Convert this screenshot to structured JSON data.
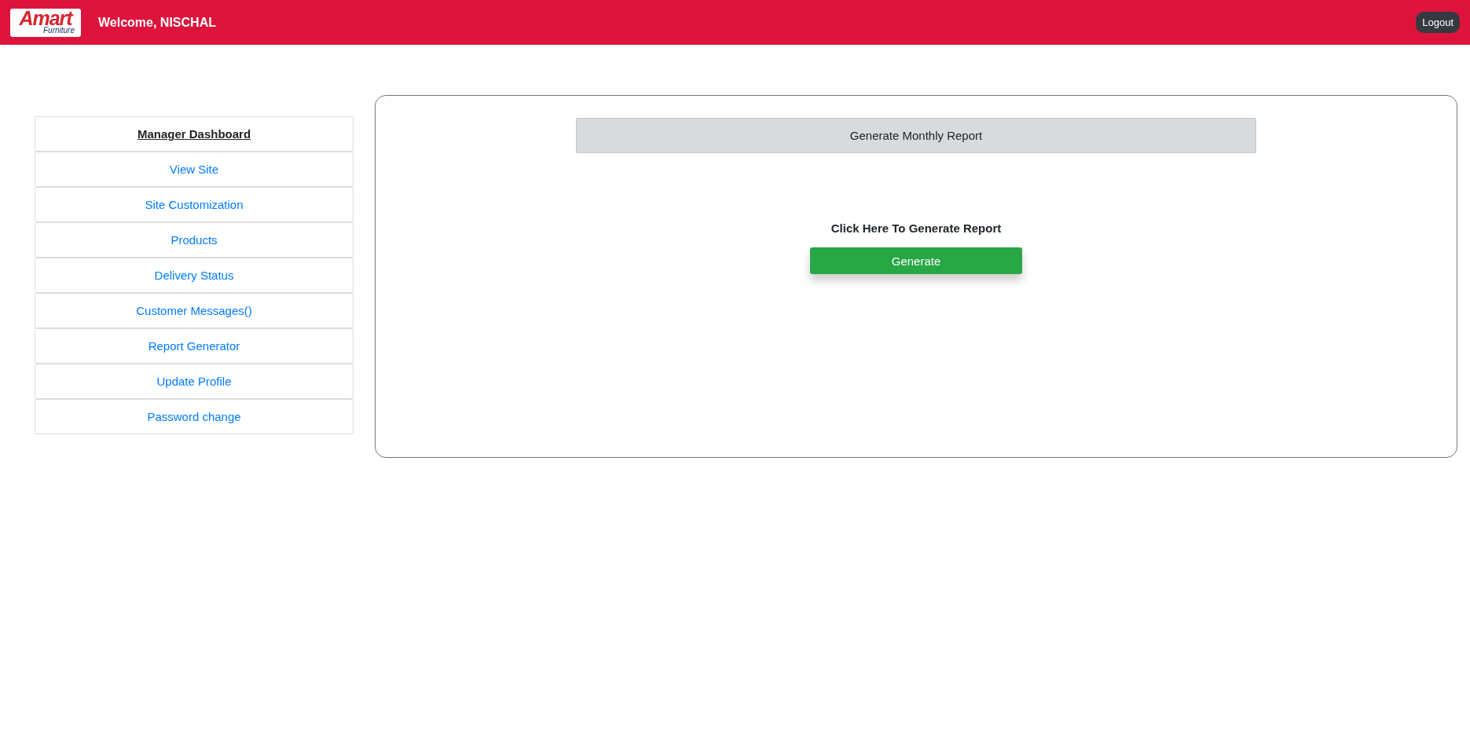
{
  "header": {
    "logo": {
      "brand": "Amart",
      "tagline": "Furniture"
    },
    "welcome": "Welcome, NISCHAL",
    "logout": "Logout"
  },
  "sidebar": {
    "items": [
      {
        "label": "Manager Dashboard",
        "kind": "heading"
      },
      {
        "label": "View Site",
        "kind": "link"
      },
      {
        "label": "Site Customization",
        "kind": "link"
      },
      {
        "label": "Products",
        "kind": "link"
      },
      {
        "label": "Delivery Status",
        "kind": "link"
      },
      {
        "label": "Customer Messages()",
        "kind": "link"
      },
      {
        "label": "Report Generator",
        "kind": "link"
      },
      {
        "label": "Update Profile",
        "kind": "link"
      },
      {
        "label": "Password change",
        "kind": "link"
      }
    ]
  },
  "panel": {
    "title": "Generate Monthly Report",
    "prompt": "Click Here To Generate Report",
    "button": "Generate"
  }
}
